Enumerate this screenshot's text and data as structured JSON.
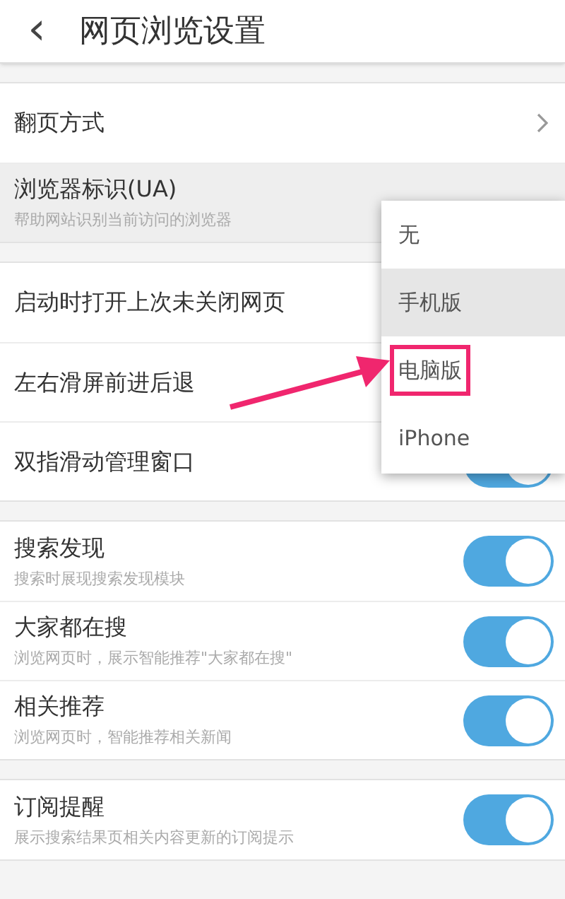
{
  "header": {
    "back": "‹",
    "title": "网页浏览设置"
  },
  "sections": [
    {
      "rows": [
        {
          "kind": "link",
          "label": "翻页方式"
        },
        {
          "kind": "select",
          "label": "浏览器标识(UA)",
          "description": "帮助网站识别当前访问的浏览器",
          "pressed": true
        }
      ]
    },
    {
      "rows": [
        {
          "kind": "plain",
          "label": "启动时打开上次未关闭网页"
        },
        {
          "kind": "plain",
          "label": "左右滑屏前进后退"
        },
        {
          "kind": "toggle",
          "label": "双指滑动管理窗口",
          "on": true
        }
      ]
    },
    {
      "rows": [
        {
          "kind": "toggle",
          "label": "搜索发现",
          "description": "搜索时展现搜索发现模块",
          "on": true
        },
        {
          "kind": "toggle",
          "label": "大家都在搜",
          "description": "浏览网页时，展示智能推荐\"大家都在搜\"",
          "on": true
        },
        {
          "kind": "toggle",
          "label": "相关推荐",
          "description": "浏览网页时，智能推荐相关新闻",
          "on": true
        }
      ]
    },
    {
      "rows": [
        {
          "kind": "toggle",
          "label": "订阅提醒",
          "description": "展示搜索结果页相关内容更新的订阅提示",
          "on": true
        }
      ]
    }
  ],
  "dropdown": {
    "options": [
      {
        "label": "无",
        "selected": false,
        "highlighted": false
      },
      {
        "label": "手机版",
        "selected": true,
        "highlighted": false
      },
      {
        "label": "电脑版",
        "selected": false,
        "highlighted": true
      },
      {
        "label": "iPhone",
        "selected": false,
        "highlighted": false
      }
    ]
  }
}
